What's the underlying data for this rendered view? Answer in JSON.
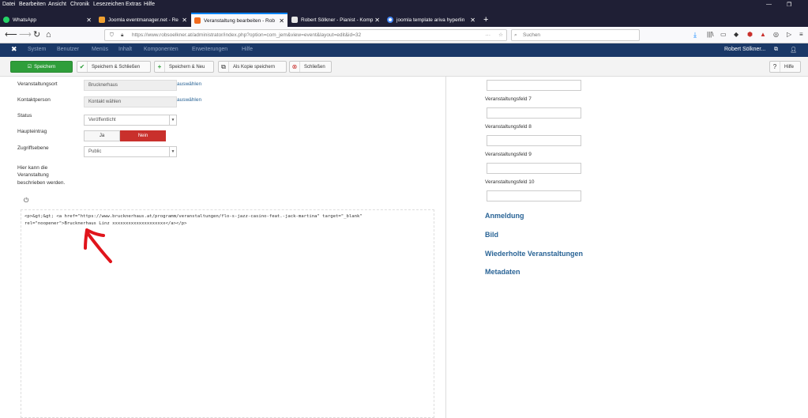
{
  "menubar": [
    "Datei",
    "Bearbeiten",
    "Ansicht",
    "Chronik",
    "Lesezeichen",
    "Extras",
    "Hilfe"
  ],
  "tabs": [
    {
      "title": "WhatsApp",
      "active": false
    },
    {
      "title": "Joomla eventmanager.net - Re",
      "active": false
    },
    {
      "title": "Veranstaltung bearbeiten - Rob",
      "active": true
    },
    {
      "title": "Robert Sölkner - Pianist - Komp",
      "active": false
    },
    {
      "title": "joomla template ariva hyperlin",
      "active": false
    }
  ],
  "url": "https://www.robsoelkner.at/administrator/index.php?option=com_jem&view=event&layout=edit&id=32",
  "url_domain": "robsoelkner.at",
  "search_placeholder": "Suchen",
  "jheader": {
    "items": [
      "System",
      "Benutzer",
      "Menüs",
      "Inhalt",
      "Komponenten",
      "Erweiterungen",
      "Hilfe"
    ],
    "user": "Robert Sölkner..."
  },
  "toolbar": {
    "save": "Speichern",
    "save_close": "Speichern & Schließen",
    "save_new": "Speichern & Neu",
    "save_copy": "Als Kopie speichern",
    "close": "Schließen",
    "help": "Hilfe"
  },
  "form": {
    "venue_label": "Veranstaltungsort",
    "venue_value": "Brucknerhaus",
    "venue_link": "auswählen",
    "contact_label": "Kontaktperson",
    "contact_value": "Kontakt wählen",
    "contact_link": "auswählen",
    "status_label": "Status",
    "status_value": "Veröffentlicht",
    "featured_label": "Haupteintrag",
    "featured_yes": "Ja",
    "featured_no": "Nein",
    "access_label": "Zugriffsebene",
    "access_value": "Public",
    "desc_label_1": "Hier kann die",
    "desc_label_2": "Veranstaltung",
    "desc_label_3": "beschrieben werden.",
    "code_line_1": "<p>&gt;&gt; <a href=\"https://www.brucknerhaus.at/programm/veranstaltungen/flo-s-jazz-casino-feat.-jack-martina\" target=\"_blank\"",
    "code_line_2": "rel=\"noopener\">Brucknerhaus Linz xxxxxxxxxxxxxxxxxxxx</a></p>"
  },
  "right": {
    "field7": "Veranstaltungsfeld 7",
    "field8": "Veranstaltungsfeld 8",
    "field9": "Veranstaltungsfeld 9",
    "field10": "Veranstaltungsfeld 10",
    "sections": [
      "Anmeldung",
      "Bild",
      "Wiederholte Veranstaltungen",
      "Metadaten"
    ]
  },
  "colors": {
    "save_green": "#2f9e3a",
    "no_red": "#c9302c",
    "joomla_blue": "#1a3867",
    "link_blue": "#2a6496",
    "annotation_red": "#e0141b"
  }
}
